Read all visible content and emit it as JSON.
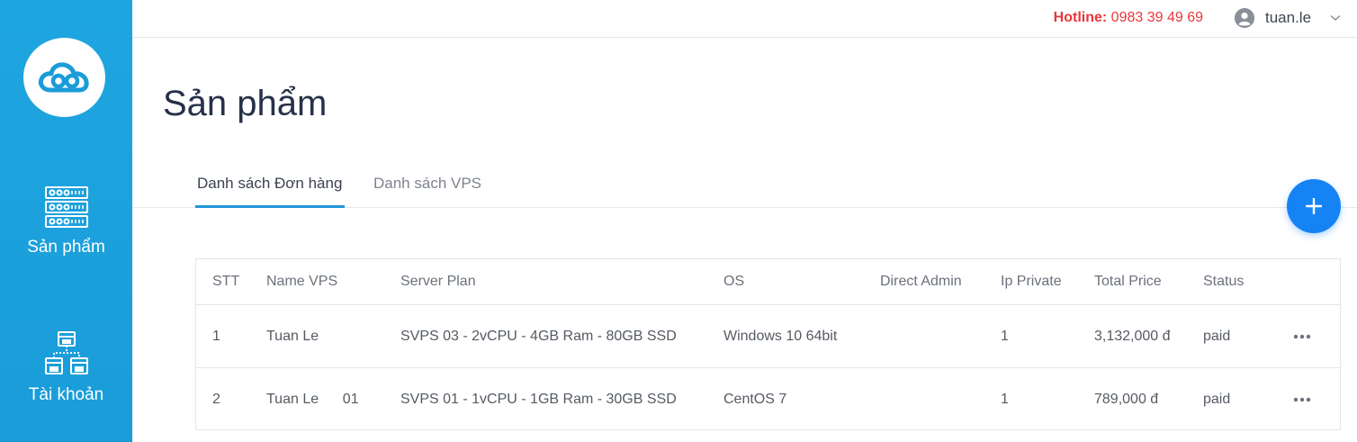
{
  "header": {
    "hotline_label": "Hotline:",
    "hotline_number": "0983 39 49 69",
    "username": "tuan.le"
  },
  "sidebar": {
    "items": [
      {
        "label": "Sản phẩm",
        "icon": "server-icon"
      },
      {
        "label": "Tài khoản",
        "icon": "account-network-icon"
      }
    ]
  },
  "page": {
    "title": "Sản phẩm"
  },
  "tabs": [
    {
      "label": "Danh sách Đơn hàng",
      "active": true
    },
    {
      "label": "Danh sách VPS",
      "active": false
    }
  ],
  "table": {
    "columns": [
      "STT",
      "Name VPS",
      "Server Plan",
      "OS",
      "Direct Admin",
      "Ip Private",
      "Total Price",
      "Status"
    ],
    "rows": [
      {
        "stt": "1",
        "name": "Tuan Le",
        "plan": "SVPS 03 - 2vCPU - 4GB Ram - 80GB SSD",
        "os": "Windows 10 64bit",
        "direct_admin": "",
        "ip_private": "1",
        "price": "3,132,000 đ",
        "status": "paid"
      },
      {
        "stt": "2",
        "name": "Tuan Le      01",
        "plan": "SVPS 01 - 1vCPU - 1GB Ram - 30GB SSD",
        "os": "CentOS 7",
        "direct_admin": "",
        "ip_private": "1",
        "price": "789,000 đ",
        "status": "paid"
      }
    ],
    "more_icon": "ellipsis-icon"
  },
  "colors": {
    "sidebar": "#1ea6e0",
    "accent": "#2196d9",
    "fab": "#1683f5",
    "hotline": "#e8373a"
  }
}
